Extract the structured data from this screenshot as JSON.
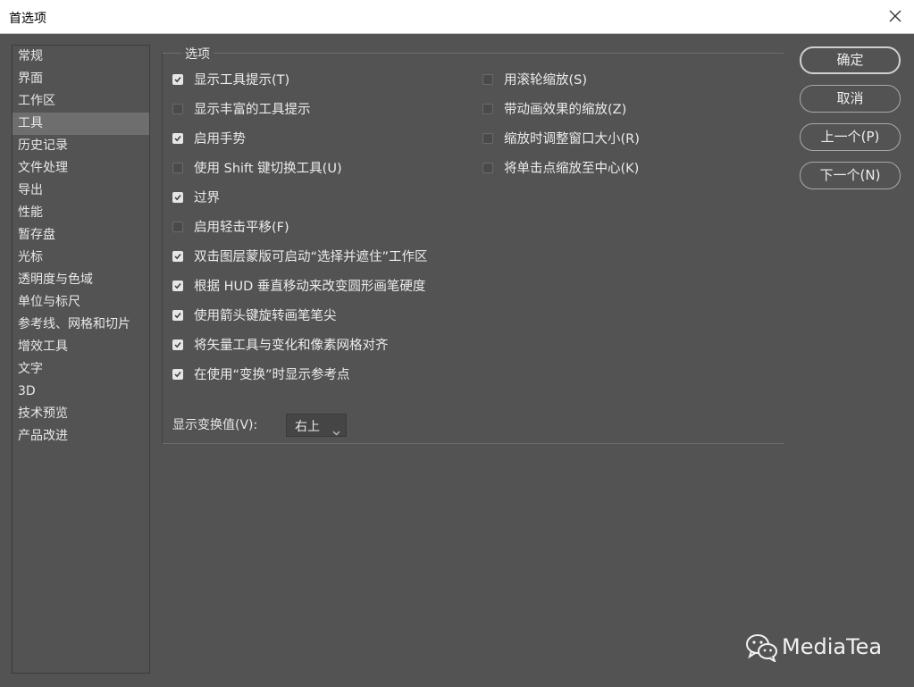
{
  "window": {
    "title": "首选项"
  },
  "sidebar": {
    "active_index": 3,
    "items": [
      {
        "label": "常规"
      },
      {
        "label": "界面"
      },
      {
        "label": "工作区"
      },
      {
        "label": "工具"
      },
      {
        "label": "历史记录"
      },
      {
        "label": "文件处理"
      },
      {
        "label": "导出"
      },
      {
        "label": "性能"
      },
      {
        "label": "暂存盘"
      },
      {
        "label": "光标"
      },
      {
        "label": "透明度与色域"
      },
      {
        "label": "单位与标尺"
      },
      {
        "label": "参考线、网格和切片"
      },
      {
        "label": "增效工具"
      },
      {
        "label": "文字"
      },
      {
        "label": "3D"
      },
      {
        "label": "技术预览"
      },
      {
        "label": "产品改进"
      }
    ]
  },
  "options": {
    "legend": "选项",
    "left": [
      {
        "label": "显示工具提示(T)",
        "checked": true
      },
      {
        "label": "显示丰富的工具提示",
        "checked": false
      },
      {
        "label": "启用手势",
        "checked": true
      },
      {
        "label": "使用 Shift 键切换工具(U)",
        "checked": false
      },
      {
        "label": "过界",
        "checked": true
      },
      {
        "label": "启用轻击平移(F)",
        "checked": false
      },
      {
        "label": "双击图层蒙版可启动“选择并遮住”工作区",
        "checked": true
      },
      {
        "label": "根据 HUD 垂直移动来改变圆形画笔硬度",
        "checked": true
      },
      {
        "label": "使用箭头键旋转画笔笔尖",
        "checked": true
      },
      {
        "label": "将矢量工具与变化和像素网格对齐",
        "checked": true
      },
      {
        "label": "在使用“变换”时显示参考点",
        "checked": true
      }
    ],
    "right": [
      {
        "label": "用滚轮缩放(S)",
        "checked": false
      },
      {
        "label": "带动画效果的缩放(Z)",
        "checked": false
      },
      {
        "label": "缩放时调整窗口大小(R)",
        "checked": false
      },
      {
        "label": "将单击点缩放至中心(K)",
        "checked": false
      }
    ],
    "transform_label": "显示变换值(V):",
    "transform_value": "右上"
  },
  "buttons": {
    "ok": "确定",
    "cancel": "取消",
    "prev": "上一个(P)",
    "next": "下一个(N)"
  },
  "watermark": {
    "text": "MediaTea",
    "icon": "wechat-icon"
  },
  "colors": {
    "background": "#535353",
    "active_item": "#6e6e6e"
  }
}
